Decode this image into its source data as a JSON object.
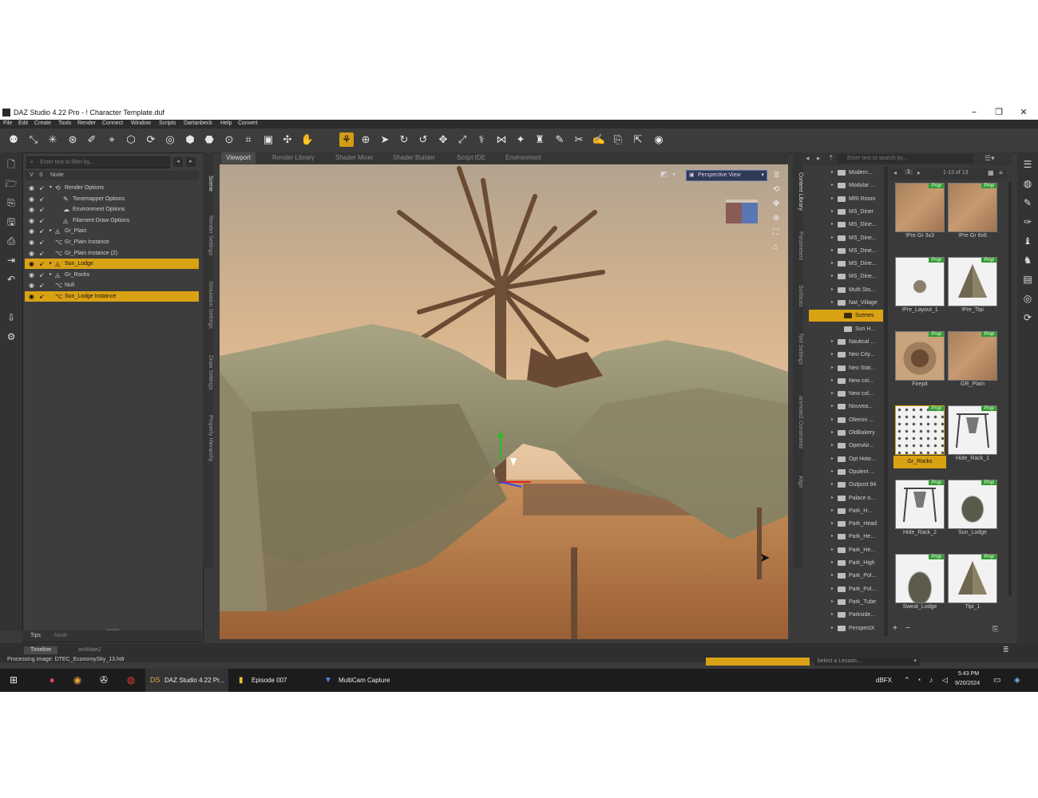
{
  "title_bar": {
    "title": "DAZ Studio 4.22 Pro - ! Character Template.duf",
    "minimize": "−",
    "restore": "❐",
    "close": "✕"
  },
  "menu": [
    "File",
    "Edit",
    "Create",
    "Tools",
    "Render",
    "Connect",
    "Window",
    "Scripts",
    "Dartanbeck",
    "Help",
    "Convert"
  ],
  "scene_pane": {
    "filter_placeholder": "Enter text to filter by...",
    "header_v": "V",
    "header_s": "S",
    "header_node": "Node",
    "rows": [
      {
        "label": "Render Options",
        "icon": "⟲",
        "tw": "▾",
        "depth": 0,
        "selected": false
      },
      {
        "label": "Tonemapper Options",
        "icon": "✎",
        "tw": "",
        "depth": 1,
        "selected": false
      },
      {
        "label": "Environment Options",
        "icon": "☁",
        "tw": "",
        "depth": 1,
        "selected": false
      },
      {
        "label": "Filament Draw Options",
        "icon": "◬",
        "tw": "",
        "depth": 1,
        "selected": false
      },
      {
        "label": "Gr_Plain",
        "icon": "◬",
        "tw": "▸",
        "depth": 0,
        "selected": false
      },
      {
        "label": "Gr_Plain Instance",
        "icon": "⌥",
        "tw": "",
        "depth": 0,
        "selected": false
      },
      {
        "label": "Gr_Plain Instance (2)",
        "icon": "⌥",
        "tw": "",
        "depth": 0,
        "selected": false
      },
      {
        "label": "Sun_Lodge",
        "icon": "◬",
        "tw": "▸",
        "depth": 0,
        "selected": true
      },
      {
        "label": "Gr_Rocks",
        "icon": "◬",
        "tw": "▸",
        "depth": 0,
        "selected": false
      },
      {
        "label": "Null",
        "icon": "⌥",
        "tw": "",
        "depth": 0,
        "selected": false
      },
      {
        "label": "Sun_Lodge Instance",
        "icon": "⌥",
        "tw": "",
        "depth": 0,
        "selected": true
      }
    ],
    "bottom_tabs": [
      "Tips",
      "Node"
    ]
  },
  "left_vtabs": [
    "Scene",
    "Render Settings",
    "Simulation Settings",
    "Draw Settings",
    "Property Hierarchy"
  ],
  "viewport_tabs": [
    "Viewport",
    "Render Library",
    "Shader Mixer",
    "Shader Builder",
    "Script IDE",
    "Environment"
  ],
  "viewport": {
    "camera": "Perspective View"
  },
  "right_vtabs": [
    "Content Library",
    "Parameters",
    "Surfaces",
    "Tool Settings",
    "animate2 Constraints",
    "Align"
  ],
  "content_library": {
    "search_placeholder": "Enter text to search by...",
    "page": "1",
    "count": "1-13 of 13",
    "tree": [
      {
        "label": "Modern...",
        "selected": false
      },
      {
        "label": "Modular ...",
        "selected": false
      },
      {
        "label": "MRI Room",
        "selected": false
      },
      {
        "label": "MS_Diner",
        "selected": false
      },
      {
        "label": "MS_Dine...",
        "selected": false
      },
      {
        "label": "MS_Dine...",
        "selected": false
      },
      {
        "label": "MS_Dine...",
        "selected": false
      },
      {
        "label": "MS_Dine...",
        "selected": false
      },
      {
        "label": "MS_Dine...",
        "selected": false
      },
      {
        "label": "Multi Sto...",
        "selected": false
      },
      {
        "label": "Nat_Village",
        "selected": false
      },
      {
        "label": "Scenes",
        "selected": true
      },
      {
        "label": "Sun H...",
        "selected": false
      },
      {
        "label": "Nautical ...",
        "selected": false
      },
      {
        "label": "Neo City...",
        "selected": false
      },
      {
        "label": "Neo Stat...",
        "selected": false
      },
      {
        "label": "New col...",
        "selected": false
      },
      {
        "label": "New col...",
        "selected": false
      },
      {
        "label": "Nouvea...",
        "selected": false
      },
      {
        "label": "Oberon ...",
        "selected": false
      },
      {
        "label": "OldBakery",
        "selected": false
      },
      {
        "label": "OpenAir...",
        "selected": false
      },
      {
        "label": "Opt Hote...",
        "selected": false
      },
      {
        "label": "Opulent ...",
        "selected": false
      },
      {
        "label": "Outpost 94",
        "selected": false
      },
      {
        "label": "Palace o...",
        "selected": false
      },
      {
        "label": "Park_H...",
        "selected": false
      },
      {
        "label": "Park_Head",
        "selected": false
      },
      {
        "label": "Park_He...",
        "selected": false
      },
      {
        "label": "Park_He...",
        "selected": false
      },
      {
        "label": "Park_High",
        "selected": false
      },
      {
        "label": "Park_Pol...",
        "selected": false
      },
      {
        "label": "Park_Pol...",
        "selected": false
      },
      {
        "label": "Park_Tube",
        "selected": false
      },
      {
        "label": "Parkside...",
        "selected": false
      },
      {
        "label": "PerspectX",
        "selected": false
      }
    ],
    "items": [
      {
        "label": "!Pre Gr 3x3",
        "badge": "Prop",
        "selected": false,
        "style": "ground"
      },
      {
        "label": "!Pre Gr 6x6",
        "badge": "Prop",
        "selected": false,
        "style": "ground"
      },
      {
        "label": "!Pre_Layout_1",
        "badge": "Prop",
        "selected": false,
        "style": "layout"
      },
      {
        "label": "!Pre_Tipi",
        "badge": "Prop",
        "selected": false,
        "style": "tipi"
      },
      {
        "label": "Firepit",
        "badge": "Prop",
        "selected": false,
        "style": "firepit"
      },
      {
        "label": "GR_Plain",
        "badge": "Prop",
        "selected": false,
        "style": "ground"
      },
      {
        "label": "Gr_Rocks",
        "badge": "Prop",
        "selected": true,
        "style": "rocks"
      },
      {
        "label": "Hide_Rack_1",
        "badge": "Prop",
        "selected": false,
        "style": "rack"
      },
      {
        "label": "Hide_Rack_2",
        "badge": "Prop",
        "selected": false,
        "style": "rack"
      },
      {
        "label": "Sun_Lodge",
        "badge": "Prop",
        "selected": false,
        "style": "lodge"
      },
      {
        "label": "Sweat_Lodge",
        "badge": "Prop",
        "selected": false,
        "style": "sweat"
      },
      {
        "label": "Tipi_1",
        "badge": "Prop",
        "selected": false,
        "style": "tipi"
      }
    ]
  },
  "status": {
    "timeline_tab": "Timeline",
    "animate_tab": "aniMate2",
    "processing": "Processing image: DTEC_EconomySky_13.hdr",
    "progress": 1.0,
    "lesson_placeholder": "Select a Lesson..."
  },
  "taskbar": {
    "daz_label": "DAZ Studio 4.22 Pr...",
    "episode_label": "Episode 007",
    "multicam_label": "MultiCam Capture",
    "tray_text": "dBFX",
    "time": "5:43 PM",
    "date": "9/20/2024"
  }
}
